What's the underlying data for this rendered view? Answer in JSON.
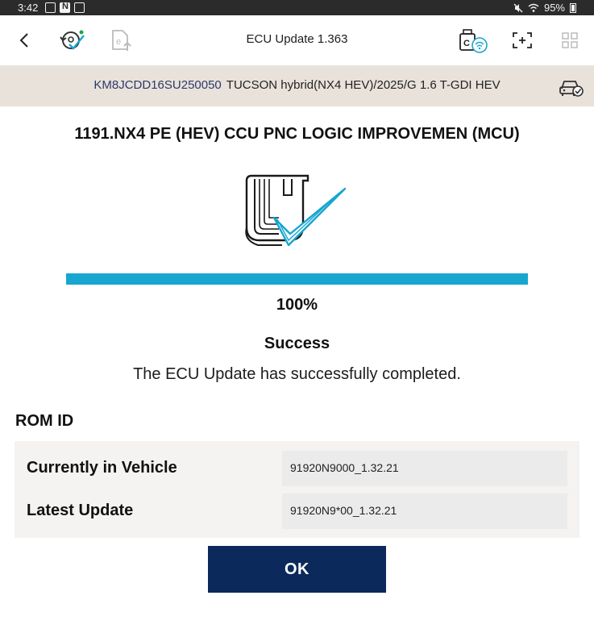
{
  "status_bar": {
    "time": "3:42",
    "battery": "95%"
  },
  "app_bar": {
    "title": "ECU Update 1.363"
  },
  "vehicle": {
    "vin": "KM8JCDD16SU250050",
    "description": "TUCSON hybrid(NX4 HEV)/2025/G 1.6 T-GDI HEV"
  },
  "update": {
    "title": "1191.NX4 PE (HEV) CCU PNC LOGIC IMPROVEMEN (MCU)",
    "progress": 100,
    "progress_label": "100%",
    "status": "Success",
    "message": "The ECU Update has successfully completed."
  },
  "rom": {
    "heading": "ROM ID",
    "rows": [
      {
        "label": "Currently in Vehicle",
        "value": "91920N9000_1.32.21"
      },
      {
        "label": "Latest Update",
        "value": "91920N9*00_1.32.21"
      }
    ]
  },
  "actions": {
    "ok_label": "OK"
  },
  "colors": {
    "progress": "#17a6cf",
    "ok_button": "#0b2a5b",
    "vehicle_band": "#e9e2da",
    "vin_text": "#2c3a6b"
  }
}
